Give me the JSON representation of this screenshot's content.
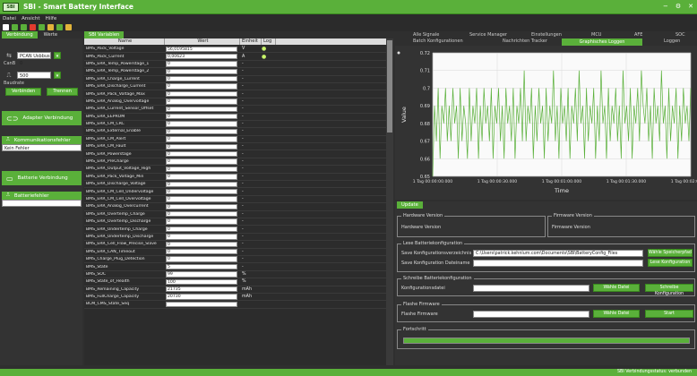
{
  "app": {
    "logo": "SBI",
    "title": "SBI - Smart Battery Interface"
  },
  "menu": [
    "Datei",
    "Ansicht",
    "Hilfe"
  ],
  "toolbar_icons": [
    {
      "name": "connect-icon",
      "color": "#ffffff"
    },
    {
      "name": "record-icon",
      "color": "#5ab03a"
    },
    {
      "name": "play-icon",
      "color": "#5ab03a"
    },
    {
      "name": "stop-icon",
      "color": "#e23b2e"
    },
    {
      "name": "target-icon",
      "color": "#5ab03a"
    },
    {
      "name": "folder-icon",
      "color": "#e2b43a"
    },
    {
      "name": "save-icon",
      "color": "#5ab03a"
    },
    {
      "name": "open-folder-icon",
      "color": "#e2b43a"
    }
  ],
  "left": {
    "tabs": [
      "Verbindung",
      "Werte"
    ],
    "can_label": "CanB",
    "can_select": "PCAN Usbbus 0",
    "baud_label": "Baudrate",
    "baud_select": "500",
    "button_connect": "Verbinden",
    "button_reconnect": "Trennen",
    "adapter_label": "Adapter Verbindung",
    "comm_label": "Kommunikationsfehler",
    "comm_status": "Kein Fehler",
    "battery_label": "Batterie Verbindung",
    "error_label": "Batteriefehler",
    "error_status": ""
  },
  "middle": {
    "tab": "SBI Variablen",
    "headers": {
      "name": "Name",
      "value": "Wert",
      "unit": "Einheit",
      "log": "Log"
    },
    "rows": [
      {
        "name": "BMS_Pack_Voltage",
        "value": "56,0195815",
        "unit": "V",
        "log": "●"
      },
      {
        "name": "BMS_Pack_Current",
        "value": "0,00623",
        "unit": "A",
        "log": "●"
      },
      {
        "name": "BMS_ERR_Temp_Powerstage_1",
        "value": "0",
        "unit": "-",
        "log": ""
      },
      {
        "name": "BMS_ERR_Temp_Powerstage_2",
        "value": "0",
        "unit": "-",
        "log": ""
      },
      {
        "name": "BMS_ERR_Charge_Current",
        "value": "0",
        "unit": "-",
        "log": ""
      },
      {
        "name": "BMS_ERR_Discharge_Current",
        "value": "0",
        "unit": "-",
        "log": ""
      },
      {
        "name": "BMS_ERR_Pack_Voltage_Max",
        "value": "0",
        "unit": "-",
        "log": ""
      },
      {
        "name": "BMS_ERR_Analog_Overvoltage",
        "value": "0",
        "unit": "-",
        "log": ""
      },
      {
        "name": "BMS_ERR_Current_Sensor_Offset",
        "value": "0",
        "unit": "-",
        "log": ""
      },
      {
        "name": "BMS_ERR_EEPROM",
        "value": "0",
        "unit": "-",
        "log": ""
      },
      {
        "name": "BMS_ERR_CM_CRC",
        "value": "0",
        "unit": "-",
        "log": ""
      },
      {
        "name": "BMS_ERR_External_Enable",
        "value": "0",
        "unit": "-",
        "log": ""
      },
      {
        "name": "BMS_ERR_CM_Alert",
        "value": "0",
        "unit": "-",
        "log": ""
      },
      {
        "name": "BMS_ERR_CM_Fault",
        "value": "0",
        "unit": "-",
        "log": ""
      },
      {
        "name": "BMS_ERR_Powerstage",
        "value": "0",
        "unit": "-",
        "log": ""
      },
      {
        "name": "BMS_ERR_PreCharge",
        "value": "0",
        "unit": "-",
        "log": ""
      },
      {
        "name": "BMS_ERR_Output_Voltage_High",
        "value": "0",
        "unit": "-",
        "log": ""
      },
      {
        "name": "BMS_ERR_Pack_Voltage_Min",
        "value": "0",
        "unit": "-",
        "log": ""
      },
      {
        "name": "BMS_ERR_Discharge_Voltage",
        "value": "0",
        "unit": "-",
        "log": ""
      },
      {
        "name": "BMS_ERR_CM_Cell_Undervoltage",
        "value": "0",
        "unit": "-",
        "log": ""
      },
      {
        "name": "BMS_ERR_CM_Cell_Overvoltage",
        "value": "0",
        "unit": "-",
        "log": ""
      },
      {
        "name": "BMS_ERR_Analog_Overcurrent",
        "value": "0",
        "unit": "-",
        "log": ""
      },
      {
        "name": "BMS_ERR_Overtemp_Charge",
        "value": "0",
        "unit": "-",
        "log": ""
      },
      {
        "name": "BMS_ERR_Overtemp_Discharge",
        "value": "0",
        "unit": "-",
        "log": ""
      },
      {
        "name": "BMS_ERR_Undertemp_Charge",
        "value": "0",
        "unit": "-",
        "log": ""
      },
      {
        "name": "BMS_ERR_Undertemp_Discharge",
        "value": "0",
        "unit": "-",
        "log": ""
      },
      {
        "name": "BMS_ERR_Cell_Flow_Precise_Slave",
        "value": "0",
        "unit": "-",
        "log": ""
      },
      {
        "name": "BMS_ERR_CAN_Timeout",
        "value": "0",
        "unit": "-",
        "log": ""
      },
      {
        "name": "BMS_Charge_Plug_Detection",
        "value": "0",
        "unit": "-",
        "log": ""
      },
      {
        "name": "BMS_State",
        "value": "5",
        "unit": "-",
        "log": ""
      },
      {
        "name": "BMS_SOC",
        "value": "99",
        "unit": "%",
        "log": ""
      },
      {
        "name": "BMS_State_of_Health",
        "value": "100",
        "unit": "%",
        "log": ""
      },
      {
        "name": "BMS_Remaining_Capacity",
        "value": "21735",
        "unit": "mAh",
        "log": ""
      },
      {
        "name": "BMS_FullCharge_Capacity",
        "value": "20730",
        "unit": "mAh",
        "log": ""
      },
      {
        "name": "BCM_CMS_State_Seq",
        "value": "",
        "unit": "",
        "log": ""
      }
    ]
  },
  "right": {
    "tabs_top": [
      "Alle Signale",
      "Service Manager",
      "Einstellungen",
      "MCU",
      "AFE",
      "SOC"
    ],
    "tabs_bottom": [
      "Batch Konfigurationen",
      "Nachrichten Tracker",
      "Graphisches Loggen",
      "Loggen"
    ],
    "active_tab": "Graphisches Loggen",
    "update_tab": "Update",
    "hw_legend": "Hardware Version",
    "hw_label": "Hardware Version",
    "fw_legend": "Firmware Version",
    "fw_label": "Firmware Version",
    "load_legend": "Lese Batteriekonfiguration",
    "save_path_label": "Save Konfigurationsverzeichnis",
    "save_path_value": "C:\\Users\\patrick.kehnlum.com\\Documents\\SBI\\BatteryConfig_Files",
    "select_save_btn": "Wähle Speicherpfad",
    "save_name_label": "Save Konfiguration Dateiname",
    "save_name_value": "",
    "read_config_btn": "Lese Konfiguration",
    "write_legend": "Schreibe Batteriekonfiguration",
    "config_file_label": "Konfigurationsdatei",
    "config_file_value": "",
    "select_file_btn": "Wähle Datei",
    "write_config_btn": "Schreibe Konfiguration",
    "fw_update_legend": "Flashe Firmware",
    "fw_file_label": "Flashe Firmware",
    "fw_file_value": "",
    "fw_select_btn": "Wähle Datei",
    "fw_start_btn": "Start",
    "progress_legend": "Fortschritt",
    "progress": 1.0
  },
  "status_bar": "SBI Verbindungsstatus: verbunden",
  "chart_data": {
    "type": "line",
    "ylabel": "Value",
    "xlabel": "Time",
    "ylim": [
      0.65,
      0.72
    ],
    "yticks": [
      "0.72",
      "0.71",
      "0.7",
      "0.69",
      "0.68",
      "0.67",
      "0.66",
      "0.65"
    ],
    "xticks": [
      "1 Tag 00:00:00.000",
      "1 Tag 00:00:30.000",
      "1 Tag 00:01:00.000",
      "1 Tag 00:01:30.000",
      "1 Tag 00:02:00.000"
    ],
    "color": "#5ab03a",
    "series": [
      {
        "values": [
          0.65,
          0.69,
          0.67,
          0.7,
          0.66,
          0.69,
          0.68,
          0.7,
          0.67,
          0.69,
          0.67,
          0.7,
          0.68,
          0.69,
          0.66,
          0.7,
          0.67,
          0.69,
          0.68,
          0.66,
          0.7,
          0.67,
          0.69,
          0.68,
          0.7,
          0.66,
          0.69,
          0.67,
          0.7,
          0.68,
          0.69,
          0.67,
          0.7,
          0.66,
          0.69,
          0.68,
          0.7,
          0.67,
          0.69,
          0.66,
          0.7,
          0.68,
          0.69,
          0.67,
          0.7,
          0.66,
          0.69,
          0.68,
          0.7,
          0.67,
          0.71,
          0.67,
          0.69,
          0.68,
          0.7,
          0.66,
          0.69,
          0.67,
          0.7,
          0.68,
          0.69,
          0.66,
          0.7,
          0.67,
          0.69,
          0.68,
          0.71,
          0.67,
          0.69,
          0.66,
          0.7,
          0.68,
          0.69,
          0.67,
          0.7,
          0.66,
          0.69,
          0.68,
          0.7,
          0.67,
          0.71,
          0.68,
          0.69,
          0.66,
          0.7,
          0.67,
          0.69,
          0.68,
          0.7,
          0.66,
          0.69,
          0.67,
          0.71,
          0.68,
          0.69,
          0.66,
          0.7,
          0.67,
          0.69,
          0.68,
          0.7,
          0.67,
          0.69,
          0.66,
          0.71,
          0.68,
          0.69,
          0.67,
          0.7,
          0.66,
          0.69,
          0.68,
          0.7,
          0.67,
          0.71,
          0.69,
          0.68,
          0.7,
          0.67,
          0.69,
          0.66,
          0.7,
          0.68,
          0.69,
          0.67,
          0.71,
          0.68,
          0.69,
          0.66,
          0.7,
          0.67,
          0.69,
          0.68,
          0.7,
          0.66,
          0.69,
          0.67,
          0.7,
          0.68,
          0.69,
          0.67,
          0.7
        ]
      }
    ]
  }
}
